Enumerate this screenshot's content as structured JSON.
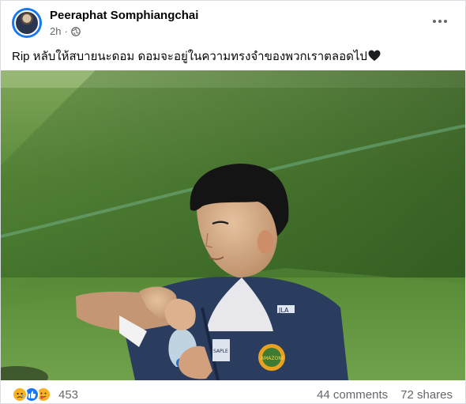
{
  "post": {
    "author": "Peeraphat Somphiangchai",
    "time": "2h",
    "text": "Rip หลับให้สบายนะดอม ดอมจะอยู่ในความทรงจำของพวกเราตลอดไป",
    "photo": {
      "jersey_logo_text": "JLA",
      "jersey_tag_text": "SAPLE",
      "crest_text": "AMAZONE"
    }
  },
  "footer": {
    "reaction_icons": [
      "sad-icon",
      "like-icon",
      "love-icon"
    ],
    "reaction_count": "453",
    "comments": "44 comments",
    "shares": "72 shares"
  },
  "colors": {
    "author_text": "#050505",
    "meta_text": "#65676b",
    "like_blue": "#1877f2",
    "sad_yellow": "#f7b125",
    "love_red": "#f33e58"
  }
}
